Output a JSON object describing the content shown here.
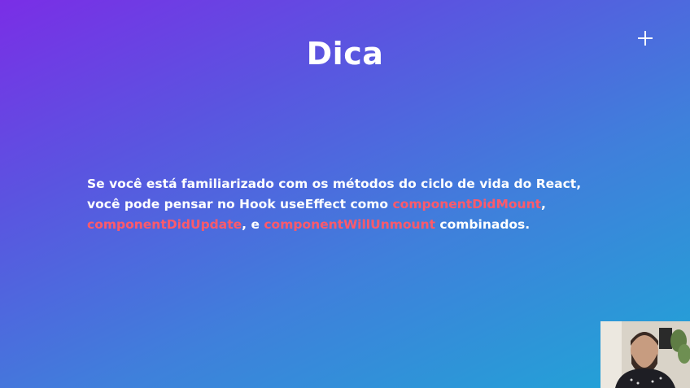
{
  "slide": {
    "title": "Dica",
    "tip": {
      "line1": "Se você está familiarizado com os métodos do ciclo de vida do React,",
      "line2_prefix": "você pode pensar no Hook useEffect como ",
      "hook1": "componentDidMount",
      "line2_suffix": ",",
      "hook2": "componentDidUpdate",
      "sep": ", e ",
      "hook3": "componentWillUnmount",
      "line3_suffix": " combinados."
    }
  },
  "icons": {
    "add": "plus-icon"
  },
  "colors": {
    "accent": "#ff5a6a",
    "text": "#ffffff"
  }
}
